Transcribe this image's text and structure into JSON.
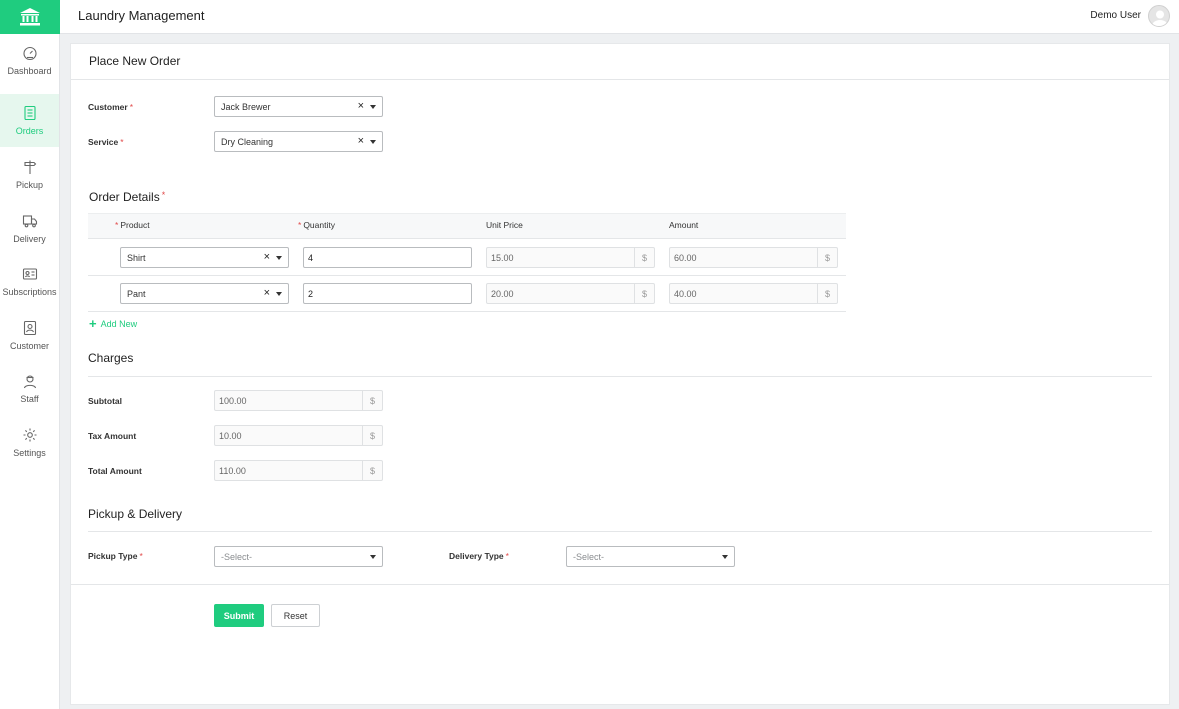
{
  "app": {
    "title": "Laundry Management",
    "user": "Demo User"
  },
  "sidebar": {
    "items": [
      {
        "label": "Dashboard",
        "icon": "dashboard-icon"
      },
      {
        "label": "Orders",
        "icon": "orders-icon",
        "active": true
      },
      {
        "label": "Pickup",
        "icon": "pickup-icon"
      },
      {
        "label": "Delivery",
        "icon": "delivery-icon"
      },
      {
        "label": "Subscriptions",
        "icon": "subscriptions-icon"
      },
      {
        "label": "Customer",
        "icon": "customer-icon"
      },
      {
        "label": "Staff",
        "icon": "staff-icon"
      },
      {
        "label": "Settings",
        "icon": "settings-icon"
      }
    ]
  },
  "form": {
    "title": "Place New Order",
    "customer": {
      "label": "Customer",
      "value": "Jack Brewer"
    },
    "service": {
      "label": "Service",
      "value": "Dry Cleaning"
    },
    "order_details": {
      "title": "Order Details",
      "headers": {
        "product": "Product",
        "quantity": "Quantity",
        "unit_price": "Unit Price",
        "amount": "Amount"
      },
      "rows": [
        {
          "product": "Shirt",
          "quantity": "4",
          "unit_price": "15.00",
          "amount": "60.00"
        },
        {
          "product": "Pant",
          "quantity": "2",
          "unit_price": "20.00",
          "amount": "40.00"
        }
      ],
      "add_new": "Add New"
    },
    "charges": {
      "title": "Charges",
      "subtotal": {
        "label": "Subtotal",
        "value": "100.00"
      },
      "tax": {
        "label": "Tax Amount",
        "value": "10.00"
      },
      "total": {
        "label": "Total Amount",
        "value": "110.00"
      }
    },
    "pickup_delivery": {
      "title": "Pickup & Delivery",
      "pickup_type": {
        "label": "Pickup Type",
        "placeholder": "-Select-"
      },
      "delivery_type": {
        "label": "Delivery Type",
        "placeholder": "-Select-"
      }
    },
    "currency": "$",
    "required_mark": "*",
    "clear_mark": "×",
    "submit": "Submit",
    "reset": "Reset"
  },
  "colors": {
    "accent": "#1fcc7f",
    "required": "#e24b4b"
  }
}
